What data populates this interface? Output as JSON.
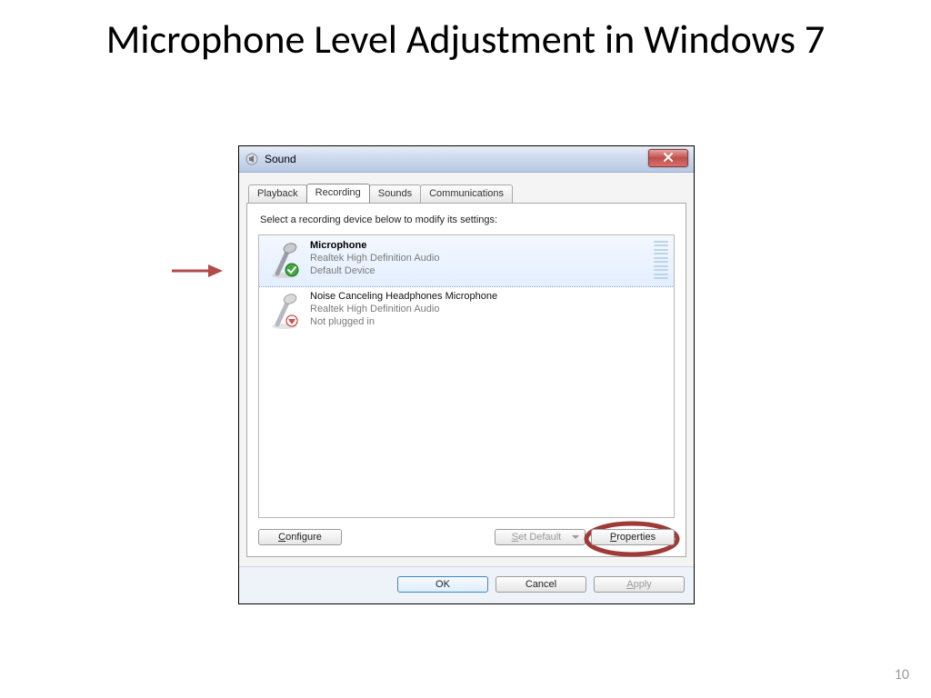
{
  "slide": {
    "title": "Microphone Level Adjustment in Windows 7",
    "page_number": "10"
  },
  "window": {
    "title": "Sound",
    "tabs": [
      "Playback",
      "Recording",
      "Sounds",
      "Communications"
    ],
    "active_tab_index": 1,
    "instruction": "Select a recording device below to modify its settings:",
    "devices": [
      {
        "name": "Microphone",
        "driver": "Realtek High Definition Audio",
        "status": "Default Device",
        "selected": true,
        "badge": "check"
      },
      {
        "name": "Noise Canceling Headphones Microphone",
        "driver": "Realtek High Definition Audio",
        "status": "Not plugged in",
        "selected": false,
        "badge": "unplugged"
      }
    ],
    "buttons": {
      "configure": "Configure",
      "set_default": "Set Default",
      "properties": "Properties",
      "ok": "OK",
      "cancel": "Cancel",
      "apply": "Apply"
    }
  },
  "annotations": {
    "arrow": "points-to-selected-device",
    "circle": "around-properties-button"
  }
}
